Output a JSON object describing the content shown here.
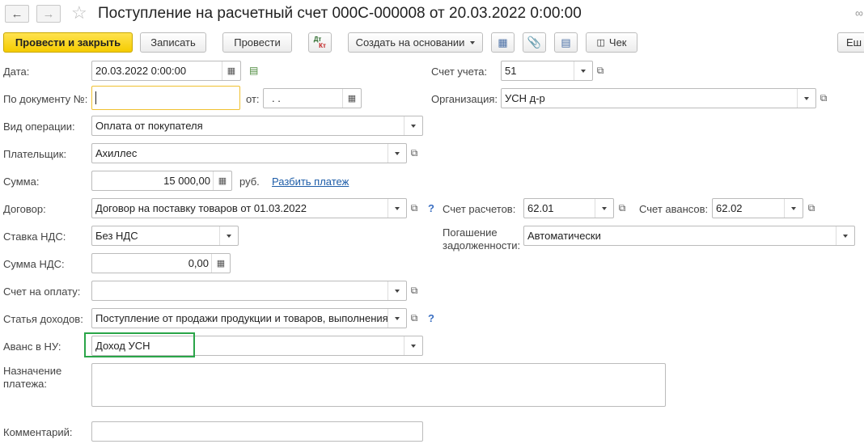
{
  "header": {
    "title": "Поступление на расчетный счет 000С-000008 от 20.03.2022 0:00:00",
    "more_label": "Еш"
  },
  "toolbar": {
    "post_close": "Провести и закрыть",
    "save": "Записать",
    "post": "Провести",
    "dt_kt_top": "Дт",
    "dt_kt_bottom": "Кт",
    "create_based": "Создать на основании",
    "receipt": "Чек"
  },
  "form": {
    "date_label": "Дата:",
    "date_value": "20.03.2022  0:00:00",
    "doc_no_label": "По документу №:",
    "doc_no_value": "",
    "from_label": "от:",
    "from_value": "  .  .",
    "op_type_label": "Вид операции:",
    "op_type_value": "Оплата от покупателя",
    "payer_label": "Плательщик:",
    "payer_value": "Ахиллес",
    "sum_label": "Сумма:",
    "sum_value": "15 000,00",
    "currency": "руб.",
    "split_link": "Разбить платеж",
    "contract_label": "Договор:",
    "contract_value": "Договор на поставку товаров от 01.03.2022",
    "vat_rate_label": "Ставка НДС:",
    "vat_rate_value": "Без НДС",
    "vat_sum_label": "Сумма НДС:",
    "vat_sum_value": "0,00",
    "invoice_label": "Счет на оплату:",
    "invoice_value": "",
    "income_item_label": "Статья доходов:",
    "income_item_value": "Поступление от продажи продукции и товаров, выполнения",
    "advance_label": "Аванс в НУ:",
    "advance_value": "Доход УСН",
    "purpose_label_1": "Назначение",
    "purpose_label_2": "платежа:",
    "purpose_value": "",
    "comment_label": "Комментарий:",
    "comment_value": "",
    "account_label": "Счет учета:",
    "account_value": "51",
    "org_label": "Организация:",
    "org_value": "УСН д-р",
    "settle_acc_label": "Счет расчетов:",
    "settle_acc_value": "62.01",
    "adv_acc_label": "Счет авансов:",
    "adv_acc_value": "62.02",
    "debt_label_1": "Погашение",
    "debt_label_2": "задолженности:",
    "debt_value": "Автоматически",
    "help_mark": "?"
  },
  "colors": {
    "primary_button": "#f5cc00",
    "focus_border": "#f0c030",
    "highlight_border": "#2aa548",
    "link": "#1e5da8"
  }
}
